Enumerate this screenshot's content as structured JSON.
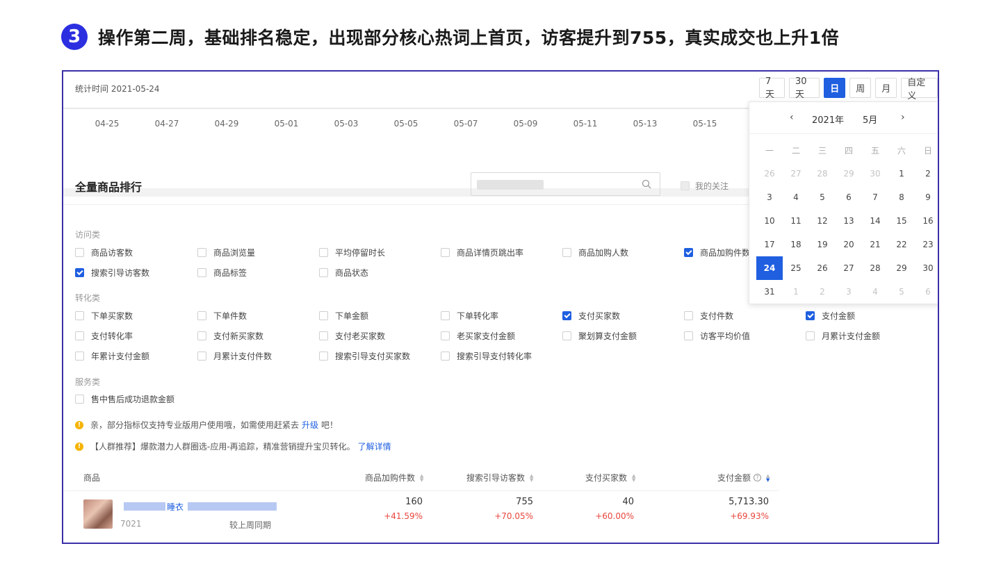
{
  "heading": {
    "step": "3",
    "text": "操作第二周，基础排名稳定，出现部分核心热词上首页，访客提升到755，真实成交也上升1倍"
  },
  "topbar": {
    "stat_time": "统计时间 2021-05-24",
    "ranges": [
      "7天",
      "30天",
      "日",
      "周",
      "月",
      "自定义"
    ],
    "active_range": "日"
  },
  "axis_dates": [
    "04-25",
    "04-27",
    "04-29",
    "05-01",
    "05-03",
    "05-05",
    "05-07",
    "05-09",
    "05-11",
    "05-13",
    "05-15"
  ],
  "section": {
    "title": "全量商品排行",
    "search_placeholder": "",
    "my_follow": "我的关注"
  },
  "categories": {
    "visit": {
      "label": "访问类",
      "items": [
        {
          "label": "商品访客数",
          "checked": false
        },
        {
          "label": "商品浏览量",
          "checked": false
        },
        {
          "label": "平均停留时长",
          "checked": false
        },
        {
          "label": "商品详情页跳出率",
          "checked": false
        },
        {
          "label": "商品加购人数",
          "checked": false
        },
        {
          "label": "商品加购件数",
          "checked": true
        },
        {
          "label": "搜索引导访客数",
          "checked": true
        },
        {
          "label": "商品标签",
          "checked": false
        },
        {
          "label": "商品状态",
          "checked": false
        }
      ]
    },
    "convert": {
      "label": "转化类",
      "items": [
        {
          "label": "下单买家数",
          "checked": false
        },
        {
          "label": "下单件数",
          "checked": false
        },
        {
          "label": "下单金额",
          "checked": false
        },
        {
          "label": "下单转化率",
          "checked": false
        },
        {
          "label": "支付买家数",
          "checked": true
        },
        {
          "label": "支付件数",
          "checked": false
        },
        {
          "label": "支付金额",
          "checked": true
        },
        {
          "label": "支付转化率",
          "checked": false
        },
        {
          "label": "支付新买家数",
          "checked": false
        },
        {
          "label": "支付老买家数",
          "checked": false
        },
        {
          "label": "老买家支付金额",
          "checked": false
        },
        {
          "label": "聚划算支付金额",
          "checked": false
        },
        {
          "label": "访客平均价值",
          "checked": false
        },
        {
          "label": "月累计支付金额",
          "checked": false
        },
        {
          "label": "年累计支付金额",
          "checked": false
        },
        {
          "label": "月累计支付件数",
          "checked": false
        },
        {
          "label": "搜索引导支付买家数",
          "checked": false
        },
        {
          "label": "搜索引导支付转化率",
          "checked": false
        }
      ]
    },
    "service": {
      "label": "服务类",
      "items": [
        {
          "label": "售中售后成功退款金额",
          "checked": false
        }
      ]
    }
  },
  "notices": {
    "n1_text": "亲，部分指标仅支持专业版用户使用哦，如需使用赶紧去",
    "n1_link": "升级",
    "n1_tail": "吧！",
    "n2_text": "【人群推荐】爆款潜力人群圈选-应用-再追踪，精准营销提升宝贝转化。",
    "n2_link": "了解详情"
  },
  "table": {
    "headers": [
      "商品",
      "商品加购件数",
      "搜索引导访客数",
      "支付买家数",
      "支付金额"
    ],
    "row": {
      "name_visible": "睡衣",
      "id": "7021",
      "compare_label": "较上周同期",
      "values": [
        "160",
        "755",
        "40",
        "5,713.30"
      ],
      "deltas": [
        "+41.59%",
        "+70.05%",
        "+60.00%",
        "+69.93%"
      ]
    }
  },
  "calendar": {
    "year": "2021年",
    "month": "5月",
    "weekdays": [
      "一",
      "二",
      "三",
      "四",
      "五",
      "六",
      "日"
    ],
    "weeks": [
      [
        "26",
        "27",
        "28",
        "29",
        "30",
        "1",
        "2"
      ],
      [
        "3",
        "4",
        "5",
        "6",
        "7",
        "8",
        "9"
      ],
      [
        "10",
        "11",
        "12",
        "13",
        "14",
        "15",
        "16"
      ],
      [
        "17",
        "18",
        "19",
        "20",
        "21",
        "22",
        "23"
      ],
      [
        "24",
        "25",
        "26",
        "27",
        "28",
        "29",
        "30"
      ],
      [
        "31",
        "1",
        "2",
        "3",
        "4",
        "5",
        "6"
      ]
    ],
    "selected": "24"
  },
  "colors": {
    "accent": "#1f5fe0",
    "badge": "#2b2fe0",
    "frame": "#3b2fa8",
    "up": "#e8453c"
  }
}
